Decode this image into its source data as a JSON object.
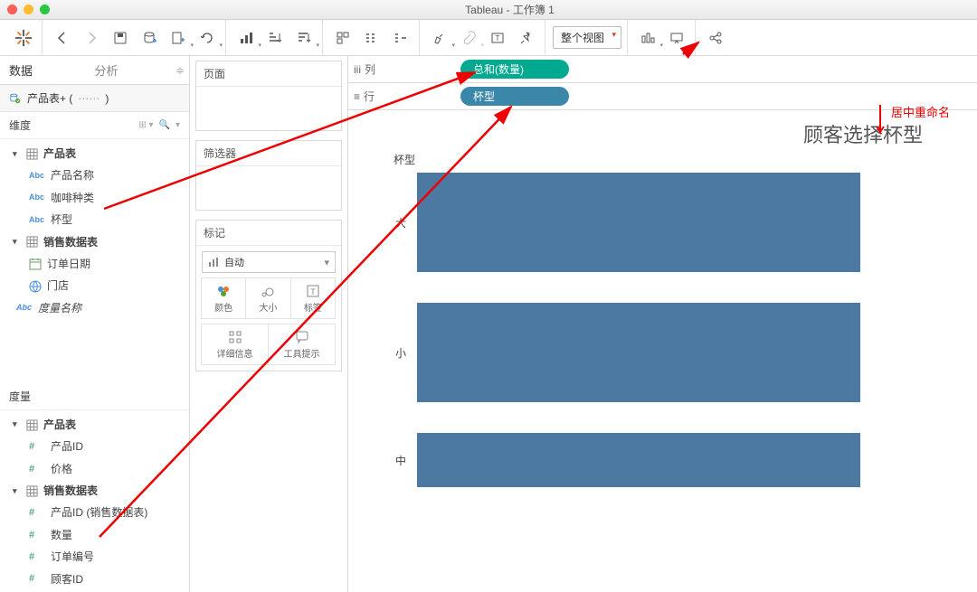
{
  "window": {
    "title": "Tableau - 工作簿 1"
  },
  "toolbar": {
    "view_mode": "整个视图"
  },
  "sidebar": {
    "tab_data": "数据",
    "tab_analysis": "分析",
    "datasource": "产品表+ (",
    "dimensions_label": "维度",
    "dim_product_table": "产品表",
    "dim_product_name": "产品名称",
    "dim_coffee_type": "咖啡种类",
    "dim_cup_type": "杯型",
    "dim_sales_table": "销售数据表",
    "dim_order_date": "订单日期",
    "dim_store": "门店",
    "dim_measure_name": "度量名称",
    "measures_label": "度量",
    "mea_product_table": "产品表",
    "mea_product_id": "产品ID",
    "mea_price": "价格",
    "mea_sales_table": "销售数据表",
    "mea_product_id_sales": "产品ID (销售数据表)",
    "mea_quantity": "数量",
    "mea_order_no": "订单编号",
    "mea_customer_id": "顾客ID"
  },
  "cards": {
    "pages": "页面",
    "filters": "筛选器",
    "marks": "标记",
    "mark_auto": "自动",
    "mark_color": "颜色",
    "mark_size": "大小",
    "mark_label": "标签",
    "mark_detail": "详细信息",
    "mark_tooltip": "工具提示"
  },
  "shelves": {
    "columns_label": "列",
    "rows_label": "行",
    "columns_pill": "总和(数量)",
    "rows_pill": "杯型"
  },
  "annotations": {
    "rename": "居中重命名"
  },
  "chart": {
    "title": "顾客选择杯型",
    "axis_title": "杯型"
  },
  "chart_data": {
    "type": "bar",
    "orientation": "horizontal",
    "categories": [
      "大",
      "小",
      "中"
    ],
    "values": [
      100,
      100,
      100
    ],
    "xlabel": "总和(数量)",
    "ylabel": "杯型",
    "title": "顾客选择杯型"
  }
}
